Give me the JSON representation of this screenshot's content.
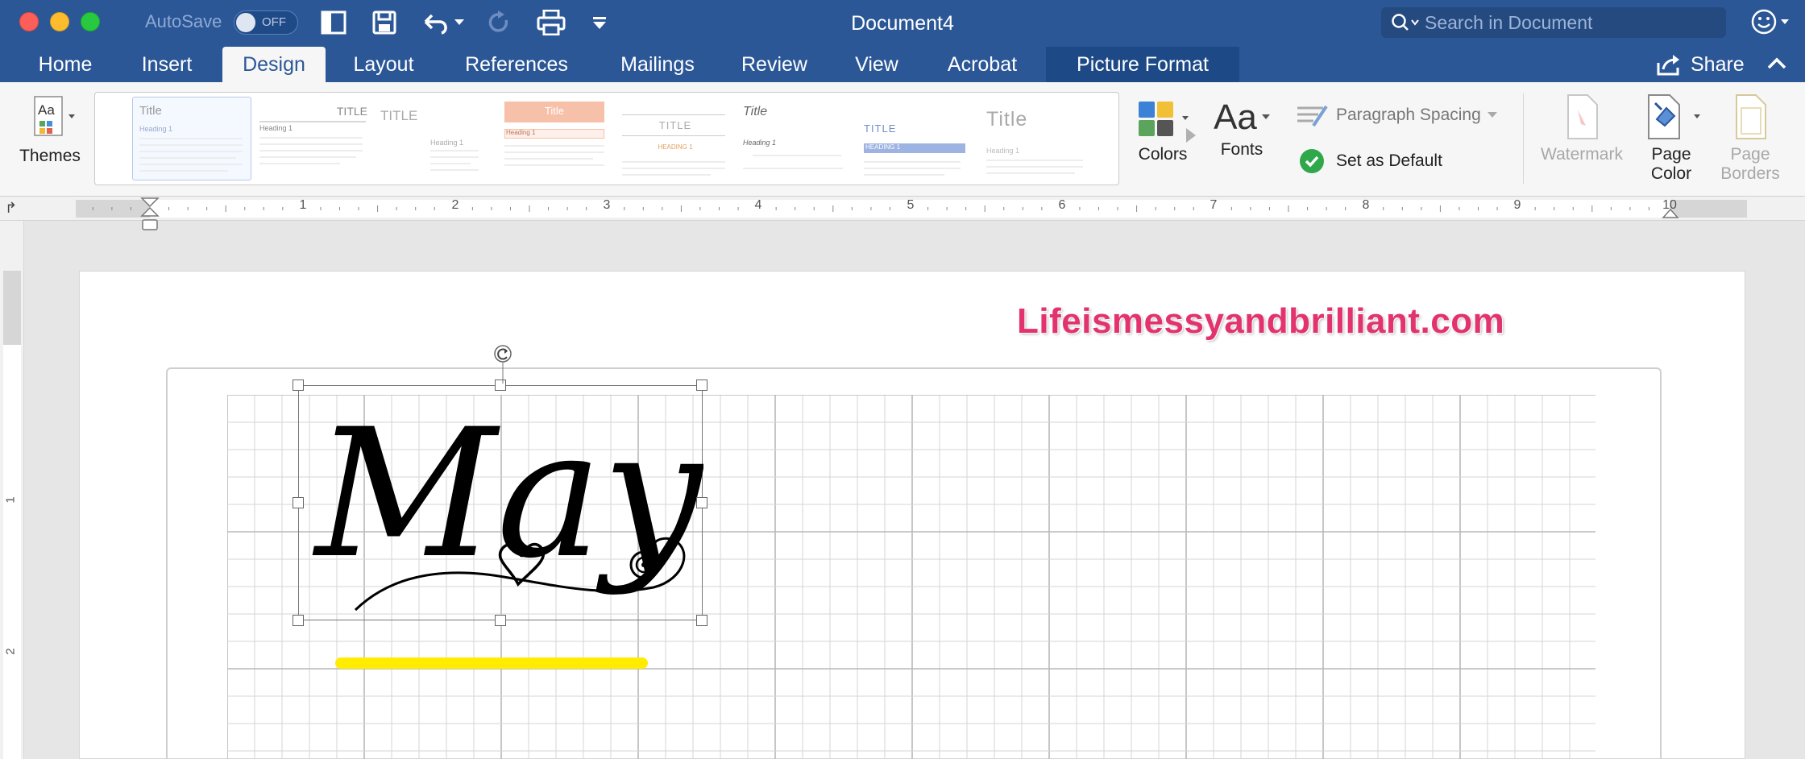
{
  "titlebar": {
    "autosave_label": "AutoSave",
    "autosave_state": "OFF",
    "document_title": "Document4",
    "search_placeholder": "Search in Document"
  },
  "tabs": [
    {
      "label": "Home"
    },
    {
      "label": "Insert"
    },
    {
      "label": "Design"
    },
    {
      "label": "Layout"
    },
    {
      "label": "References"
    },
    {
      "label": "Mailings"
    },
    {
      "label": "Review"
    },
    {
      "label": "View"
    },
    {
      "label": "Acrobat"
    },
    {
      "label": "Picture Format"
    }
  ],
  "active_tab": "Design",
  "share_label": "Share",
  "ribbon": {
    "themes_label": "Themes",
    "style_titles": [
      "Title",
      "TITLE",
      "TITLE",
      "Title",
      "TITLE",
      "Title",
      "TITLE",
      "Title"
    ],
    "style_headings": [
      "Heading 1",
      "Heading 1",
      "Heading 1",
      "Heading 1",
      "HEADING 1",
      "Heading 1",
      "HEADING 1",
      "Heading 1"
    ],
    "colors_label": "Colors",
    "fonts_label": "Fonts",
    "fonts_glyph": "Aa",
    "paragraph_spacing_label": "Paragraph Spacing",
    "set_default_label": "Set as Default",
    "watermark_label": "Watermark",
    "page_color_label": "Page\nColor",
    "page_borders_label": "Page\nBorders"
  },
  "ruler": {
    "numbers": [
      "1",
      "2",
      "3",
      "4",
      "5",
      "6",
      "7",
      "8",
      "9",
      "10"
    ],
    "vertical_numbers": [
      "1",
      "2"
    ]
  },
  "document": {
    "header_text": "Lifeismessyandbrilliant.com",
    "picture_text": "May"
  },
  "colors": {
    "title_bar": "#2b5797",
    "ribbon_bg": "#f6f6f6",
    "header_text": "#e3336e",
    "highlight": "#ffec00",
    "check_green": "#2ea84a"
  }
}
